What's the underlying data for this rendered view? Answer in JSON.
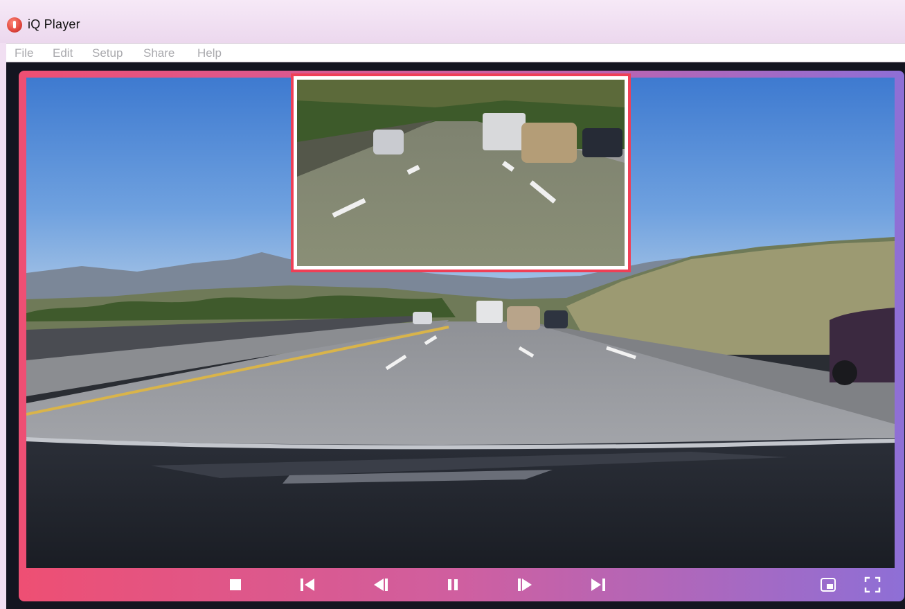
{
  "window": {
    "title": "iQ Player"
  },
  "menu": {
    "items": [
      "File",
      "Edit",
      "Setup",
      "Share",
      "Help"
    ]
  },
  "colors": {
    "frame_left": "#ee4f73",
    "frame_right": "#8e6fd6",
    "pip_border": "#ef3f56",
    "control_icon": "#ffffff"
  },
  "video": {
    "main_view": "front-dashcam-highway",
    "pip_view": "front-camera-zoomed"
  },
  "controls": {
    "icons": [
      "stop-icon",
      "skip-to-start-icon",
      "step-back-icon",
      "pause-icon",
      "step-forward-icon",
      "skip-to-end-icon",
      "picture-in-picture-icon",
      "fullscreen-icon"
    ]
  }
}
